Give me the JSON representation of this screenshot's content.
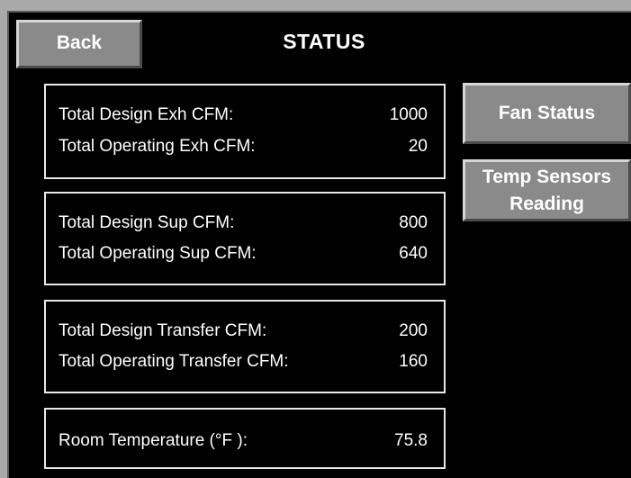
{
  "header": {
    "title": "STATUS",
    "back_label": "Back"
  },
  "side_buttons": {
    "fan_status": "Fan Status",
    "temp_sensors_line1": "Temp Sensors",
    "temp_sensors_line2": "Reading"
  },
  "panels": {
    "exhaust": {
      "design_label": "Total Design Exh CFM:",
      "design_value": "1000",
      "operating_label": "Total Operating Exh CFM:",
      "operating_value": "20"
    },
    "supply": {
      "design_label": "Total Design Sup CFM:",
      "design_value": "800",
      "operating_label": "Total Operating Sup CFM:",
      "operating_value": "640"
    },
    "transfer": {
      "design_label": "Total Design Transfer CFM:",
      "design_value": "200",
      "operating_label": "Total Operating Transfer CFM:",
      "operating_value": "160"
    },
    "room": {
      "temp_label": "Room Temperature (°F ):",
      "temp_value": "75.8"
    }
  },
  "colors": {
    "screen_bg": "#000000",
    "button_face": "#8a8a8a",
    "text": "#ffffff",
    "panel_border": "#e8e8e8"
  }
}
